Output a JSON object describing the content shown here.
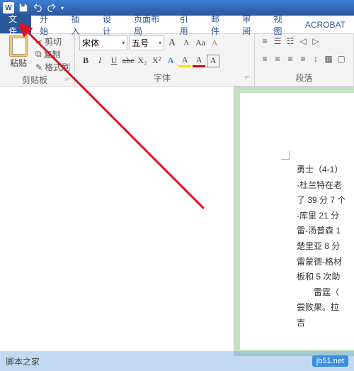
{
  "titlebar": {
    "qat": [
      "save",
      "undo",
      "redo",
      "customize"
    ]
  },
  "tabs": {
    "file": "文件",
    "home": "开始",
    "insert": "插入",
    "design": "设计",
    "layout": "页面布局",
    "references": "引用",
    "mailings": "邮件",
    "review": "审阅",
    "view": "视图",
    "acrobat": "ACROBAT"
  },
  "clipboard": {
    "paste": "粘贴",
    "cut": "剪切",
    "copy": "复制",
    "painter": "格式刷",
    "label": "剪贴板"
  },
  "font": {
    "name": "宋体",
    "size": "五号",
    "grow": "A",
    "shrink": "A",
    "case": "Aa",
    "clear": "A",
    "bold": "B",
    "italic": "I",
    "underline": "U",
    "strike": "abc",
    "sub": "X₂",
    "sup": "X²",
    "effects": "A",
    "highlight": "A",
    "color": "A",
    "box": "A",
    "label": "字体"
  },
  "paragraph": {
    "label": "段落"
  },
  "document": {
    "lines": [
      "勇士（4-1）",
      "-杜兰特在老",
      "了 39 分 7 个",
      "-库里 21 分",
      "雷-汤普森 1",
      "楚里亚 8 分",
      "雷蒙德-格材",
      "板和 5 次助",
      "",
      "　　雷霆（",
      "尝败果。拉",
      "吉"
    ]
  },
  "footer": {
    "site": "脚本之家",
    "badge": "jb51.net"
  }
}
